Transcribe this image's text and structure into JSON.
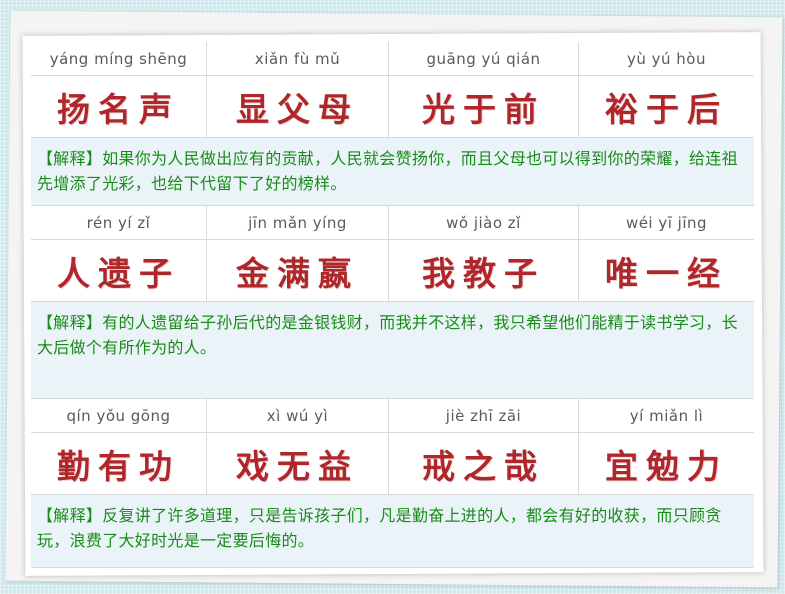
{
  "blocks": [
    {
      "cells": [
        {
          "pinyin": "yáng míng shēng",
          "chars": "扬名声"
        },
        {
          "pinyin": "xiǎn fù mǔ",
          "chars": "显父母"
        },
        {
          "pinyin": "guāng yú qián",
          "chars": "光于前"
        },
        {
          "pinyin": "yù yú hòu",
          "chars": "裕于后"
        }
      ],
      "tag": "【解释】",
      "explanation": "如果你为人民做出应有的贡献，人民就会赞扬你，而且父母也可以得到你的荣耀，给连祖先增添了光彩，也给下代留下了好的榜样。"
    },
    {
      "cells": [
        {
          "pinyin": "rén yí zǐ",
          "chars": "人遗子"
        },
        {
          "pinyin": "jīn mǎn yíng",
          "chars": "金满嬴"
        },
        {
          "pinyin": "wǒ jiào zǐ",
          "chars": "我教子"
        },
        {
          "pinyin": "wéi yī jīng",
          "chars": "唯一经"
        }
      ],
      "tag": "【解释】",
      "explanation": "有的人遗留给子孙后代的是金银钱财，而我并不这样，我只希望他们能精于读书学习，长大后做个有所作为的人。"
    },
    {
      "cells": [
        {
          "pinyin": "qín yǒu gōng",
          "chars": "勤有功"
        },
        {
          "pinyin": "xì wú yì",
          "chars": "戏无益"
        },
        {
          "pinyin": "jiè zhī zāi",
          "chars": "戒之哉"
        },
        {
          "pinyin": "yí miǎn lì",
          "chars": "宜勉力"
        }
      ],
      "tag": "【解释】",
      "explanation": "反复讲了许多道理，只是告诉孩子们，凡是勤奋上进的人，都会有好的收获，而只顾贪玩，浪费了大好时光是一定要后悔的。"
    }
  ]
}
